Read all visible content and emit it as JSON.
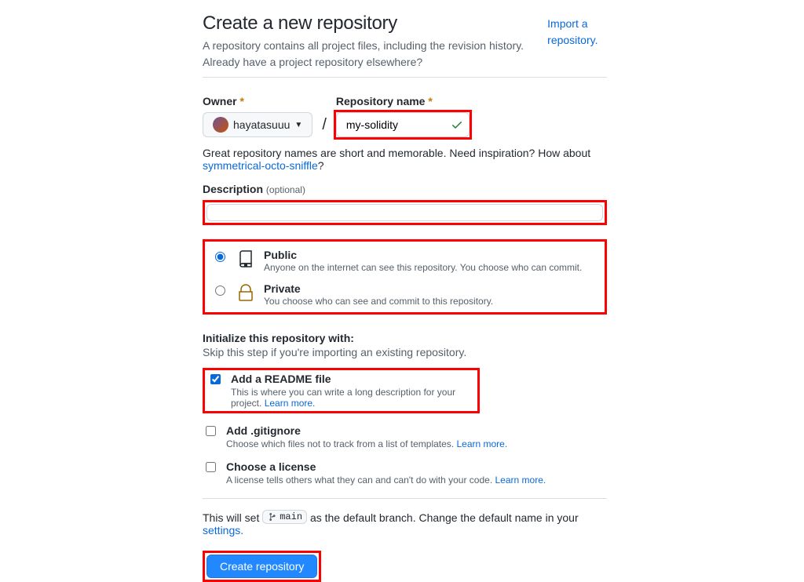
{
  "header": {
    "title": "Create a new repository",
    "subtitle": "A repository contains all project files, including the revision history. Already have a project repository elsewhere?",
    "import_link": "Import a repository."
  },
  "owner": {
    "label": "Owner",
    "value": "hayatasuuu"
  },
  "repo": {
    "label": "Repository name",
    "value": "my-solidity"
  },
  "hint": {
    "prefix": "Great repository names are short and memorable. Need inspiration? How about ",
    "suggestion": "symmetrical-octo-sniffle",
    "suffix": "?"
  },
  "description": {
    "label": "Description",
    "optional": "(optional)",
    "value": ""
  },
  "visibility": {
    "public": {
      "title": "Public",
      "desc": "Anyone on the internet can see this repository. You choose who can commit."
    },
    "private": {
      "title": "Private",
      "desc": "You choose who can see and commit to this repository."
    }
  },
  "init": {
    "title": "Initialize this repository with:",
    "subtitle": "Skip this step if you're importing an existing repository."
  },
  "readme": {
    "title": "Add a README file",
    "desc": "This is where you can write a long description for your project. ",
    "learn": "Learn more."
  },
  "gitignore": {
    "title": "Add .gitignore",
    "desc": "Choose which files not to track from a list of templates. ",
    "learn": "Learn more."
  },
  "license": {
    "title": "Choose a license",
    "desc": "A license tells others what they can and can't do with your code. ",
    "learn": "Learn more."
  },
  "branch": {
    "prefix": "This will set ",
    "name": "main",
    "mid": " as the default branch. Change the default name in your ",
    "settings": "settings."
  },
  "submit": {
    "label": "Create repository"
  }
}
